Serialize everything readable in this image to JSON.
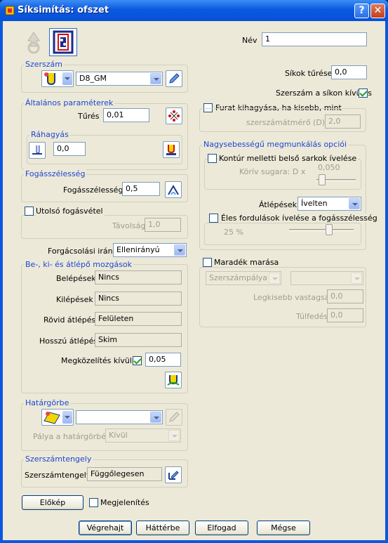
{
  "window": {
    "title": "Síksimítás: ofszet",
    "help_label": "?",
    "close_label": "✕"
  },
  "nev": {
    "label": "Név",
    "value": "1"
  },
  "szerszam": {
    "title": "Szerszám",
    "tool_value": "D8_GM"
  },
  "sikok_turese": {
    "label": "Síkok tűrése",
    "value": "0,0"
  },
  "szerszam_sikon_kivul": {
    "label": "Szerszám a síkon kívül is",
    "checked": true
  },
  "altalanos": {
    "title": "Általános paraméterek",
    "tures_label": "Tűrés",
    "tures_value": "0,01"
  },
  "rahagyas": {
    "title": "Ráhagyás",
    "value": "0,0"
  },
  "furat": {
    "label": "Furat kihagyása, ha kisebb, mint",
    "diam_label": "szerszámátmérő (D) x",
    "diam_value": "2,0",
    "checked": false
  },
  "fogasszelesseg": {
    "title": "Fogásszélesség",
    "label": "Fogásszélesség",
    "value": "0,5"
  },
  "nagysebessegu": {
    "title": "Nagysebességű megmunkálás opciói",
    "kontur_label": "Kontúr melletti belső sarkok ívelése",
    "kontur_checked": false,
    "koriv_label": "Körív sugara: D x",
    "koriv_value": "0,050",
    "atlepesek_label": "Átlépések",
    "atlepesek_value": "Ívelten",
    "eles_label": "Éles fordulások ívelése a fogásszélesség",
    "eles_checked": false,
    "eles_percent": "25 %"
  },
  "utolso": {
    "label": "Utolsó fogásvétel",
    "checked": false,
    "tavolsag_label": "Távolság",
    "tavolsag_value": "1,0"
  },
  "forgacsolasi": {
    "label": "Forgácsolási irány",
    "value": "Ellenirányú"
  },
  "mozgasok": {
    "title": "Be-, ki- és átlépő mozgások",
    "belepesek_label": "Belépések",
    "belepesek_value": "Nincs",
    "kilepesek_label": "Kilépések",
    "kilepesek_value": "Nincs",
    "rovid_label": "Rövid átlépés",
    "rovid_value": "Felületen",
    "hosszu_label": "Hosszú átlépés",
    "hosszu_value": "Skim",
    "megkozelites_label": "Megközelítés kívülről",
    "megkozelites_checked": true,
    "megkozelites_value": "0,05"
  },
  "maradek": {
    "label": "Maradék marása",
    "checked": false,
    "type_value": "Szerszámpálya",
    "second_value": "",
    "vastagsag_label": "Legkisebb vastagság",
    "vastagsag_value": "0,0",
    "tulfedes_label": "Túlfedés",
    "tulfedes_value": "0,0"
  },
  "hatargorbe": {
    "title": "Határgörbe",
    "value": "",
    "palya_label": "Pálya a határgörbén",
    "palya_value": "Kívül"
  },
  "szerszamtengely": {
    "title": "Szerszámtengely",
    "label": "Szerszámtengely",
    "value": "Függőlegesen"
  },
  "preview": {
    "button": "Előkép",
    "megjelenites_label": "Megjelenítés",
    "megjelenites_checked": false
  },
  "actions": {
    "execute": "Végrehajt",
    "background": "Háttérbe",
    "accept": "Elfogad",
    "cancel": "Mégse"
  }
}
